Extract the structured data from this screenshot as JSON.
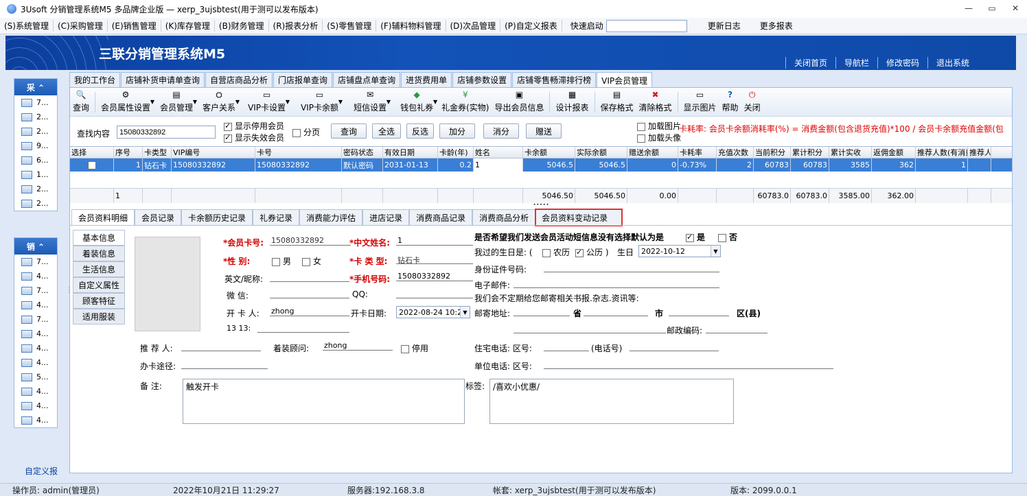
{
  "window": {
    "title": "3Usoft 分销管理系统M5 多品牌企业版 — xerp_3ujsbtest(用于测可以发布版本)",
    "min": "—",
    "max": "▭",
    "close": "✕"
  },
  "menu": [
    "(S)系统管理",
    "(C)采购管理",
    "(E)销售管理",
    "(K)库存管理",
    "(B)财务管理",
    "(R)报表分析",
    "(S)零售管理",
    "(F)辅料物料管理",
    "(D)次品管理",
    "(P)自定义报表"
  ],
  "quick_launch": "快速启动",
  "menu_right": [
    "更新日志",
    "更多报表"
  ],
  "banner": {
    "brand": "三联分销管理系统M5",
    "links": [
      "关闭首页",
      "导航栏",
      "修改密码",
      "退出系统"
    ]
  },
  "left": {
    "group1": {
      "title": "采 ⌃",
      "items": [
        "7...",
        "2...",
        "2...",
        "9...",
        "6...",
        "1...",
        "2...",
        "2..."
      ]
    },
    "group2": {
      "title": "销 ⌃",
      "items": [
        "7...",
        "4...",
        "7...",
        "4...",
        "7...",
        "4...",
        "4...",
        "4...",
        "5...",
        "4...",
        "4...",
        "4..."
      ]
    },
    "custom": "自定义报"
  },
  "tabs": [
    "我的工作台",
    "店铺补货申请单查询",
    "自营店商品分析",
    "门店报单查询",
    "店铺盘点单查询",
    "进货费用单",
    "店铺参数设置",
    "店铺零售畅滞排行榜",
    "VIP会员管理"
  ],
  "toolbar": [
    {
      "label": "查询",
      "icon": "search-icon",
      "glyph": "🔍",
      "dd": false
    },
    {
      "label": "会员属性设置",
      "icon": "member-attr-icon",
      "glyph": "⚙",
      "dd": true
    },
    {
      "label": "会员管理",
      "icon": "member-manage-icon",
      "glyph": "▤",
      "dd": true
    },
    {
      "label": "客户关系",
      "icon": "relation-icon",
      "glyph": "⛭",
      "dd": true
    },
    {
      "label": "VIP卡设置",
      "icon": "vip-card-icon",
      "glyph": "▭",
      "dd": true
    },
    {
      "label": "VIP卡余额",
      "icon": "vip-balance-icon",
      "glyph": "▭",
      "dd": true
    },
    {
      "label": "短信设置",
      "icon": "sms-icon",
      "glyph": "✉",
      "dd": true
    },
    {
      "label": "钱包礼券",
      "icon": "wallet-icon",
      "glyph": "◆",
      "dd": true
    },
    {
      "label": "礼金券(实物)",
      "icon": "yen-icon",
      "glyph": "¥",
      "dd": false
    },
    {
      "label": "导出会员信息",
      "icon": "export-icon",
      "glyph": "▣",
      "dd": false
    },
    {
      "label": "设计报表",
      "icon": "design-icon",
      "glyph": "▦",
      "dd": false
    },
    {
      "label": "保存格式",
      "icon": "save-format-icon",
      "glyph": "▤",
      "dd": false
    },
    {
      "label": "清除格式",
      "icon": "clear-format-icon",
      "glyph": "✖",
      "dd": false
    },
    {
      "label": "显示图片",
      "icon": "image-icon",
      "glyph": "▭",
      "dd": false
    },
    {
      "label": "帮助",
      "icon": "help-icon",
      "glyph": "?",
      "dd": false
    },
    {
      "label": "关闭",
      "icon": "close-icon",
      "glyph": "⏻",
      "dd": false
    }
  ],
  "search": {
    "label": "查找内容",
    "value": "15080332892",
    "show_disabled": "显示停用会员",
    "show_invalid": "显示失效会员",
    "paging": "分页",
    "buttons": [
      "查询",
      "全选",
      "反选",
      "加分",
      "消分",
      "赠送"
    ],
    "load_img": "加载图片",
    "load_avatar": "加载头像",
    "note": "卡耗率: 会员卡余额消耗率(%) = 消费金额(包含退货充值)*100 / 会员卡余额充值金额(包"
  },
  "grid": {
    "headers": [
      "选择",
      "序号",
      "卡类型",
      "VIP编号",
      "卡号",
      "密码状态",
      "有效日期",
      "卡龄(年)",
      "姓名",
      "卡余额",
      "实际余额",
      "赠送余额",
      "卡耗率",
      "充值次数",
      "当前积分",
      "累计积分",
      "累计实收",
      "返佣金额",
      "推荐人数(有消费)",
      "推荐人"
    ],
    "row": [
      "",
      "1",
      "钻石卡",
      "15080332892",
      "15080332892",
      "默认密码",
      "2031-01-13",
      "0.2",
      "1",
      "5046.5",
      "5046.5",
      "0",
      "-0.73%",
      "2",
      "60783",
      "60783",
      "3585",
      "362",
      "1",
      ""
    ],
    "summary": [
      "",
      "1",
      "",
      "",
      "",
      "",
      "",
      "",
      "",
      "5046.50",
      "5046.50",
      "0.00",
      "",
      "",
      "60783.0",
      "60783.0",
      "3585.00",
      "362.00",
      "",
      ""
    ]
  },
  "subtabs": [
    "会员资料明细",
    "会员记录",
    "卡余额历史记录",
    "礼券记录",
    "消费能力评估",
    "进店记录",
    "消费商品记录",
    "消费商品分析",
    "会员资料变动记录"
  ],
  "vtabs": [
    "基本信息",
    "着装信息",
    "生活信息",
    "自定义属性",
    "顾客特征",
    "适用服装"
  ],
  "form": {
    "card_no_label": "*会员卡号:",
    "card_no": "15080332892",
    "cn_name_label": "*中文姓名:",
    "cn_name": "1",
    "sex_label": "*性    别:",
    "male": "男",
    "female": "女",
    "card_type_label": "*卡 类 型:",
    "card_type": "钻石卡",
    "en_name_label": "英文/昵称:",
    "mobile_label": "*手机号码:",
    "mobile": "15080332892",
    "wechat_label": "微    信:",
    "qq_label": "QQ:",
    "opener_label": "开 卡 人:",
    "opener": "zhong",
    "open_date_label": "开卡日期:",
    "open_date": "2022-08-24 10:2",
    "misc": "13 13:",
    "recommender_label": "推 荐 人:",
    "stylist_label": "着装顾问:",
    "stylist": "zhong",
    "disabled_label": "停用",
    "channel_label": "办卡途径:",
    "remark_label": "备    注:",
    "remark": "触发开卡",
    "tag_label": "标签:",
    "tag": "/喜欢小优惠/",
    "sms_question": "是否希望我们发送会员活动短信息没有选择默认为是",
    "yes": "是",
    "no": "否",
    "birthday_label": "我过的生日是: (",
    "lunar": "农历",
    "solar": "公历 )",
    "birthday_word": "生日",
    "birthday": "2022-10-12",
    "id_label": "身份证件号码:",
    "email_label": "电子邮件:",
    "promo": "我们会不定期给您邮寄相关书报.杂志.资讯等:",
    "addr_label": "邮寄地址:",
    "province": "省",
    "city": "市",
    "district": "区(县)",
    "zip_label": "邮政编码:",
    "home_label": "住宅电话: 区号:",
    "tel_label": "(电话号)",
    "work_label": "单位电话: 区号:"
  },
  "status": {
    "operator": "操作员: admin(管理员)",
    "time": "2022年10月21日 11:29:27",
    "server": "服务器:192.168.3.8",
    "account": "帐套: xerp_3ujsbtest(用于测可以发布版本)",
    "version": "版本: 2099.0.0.1"
  }
}
